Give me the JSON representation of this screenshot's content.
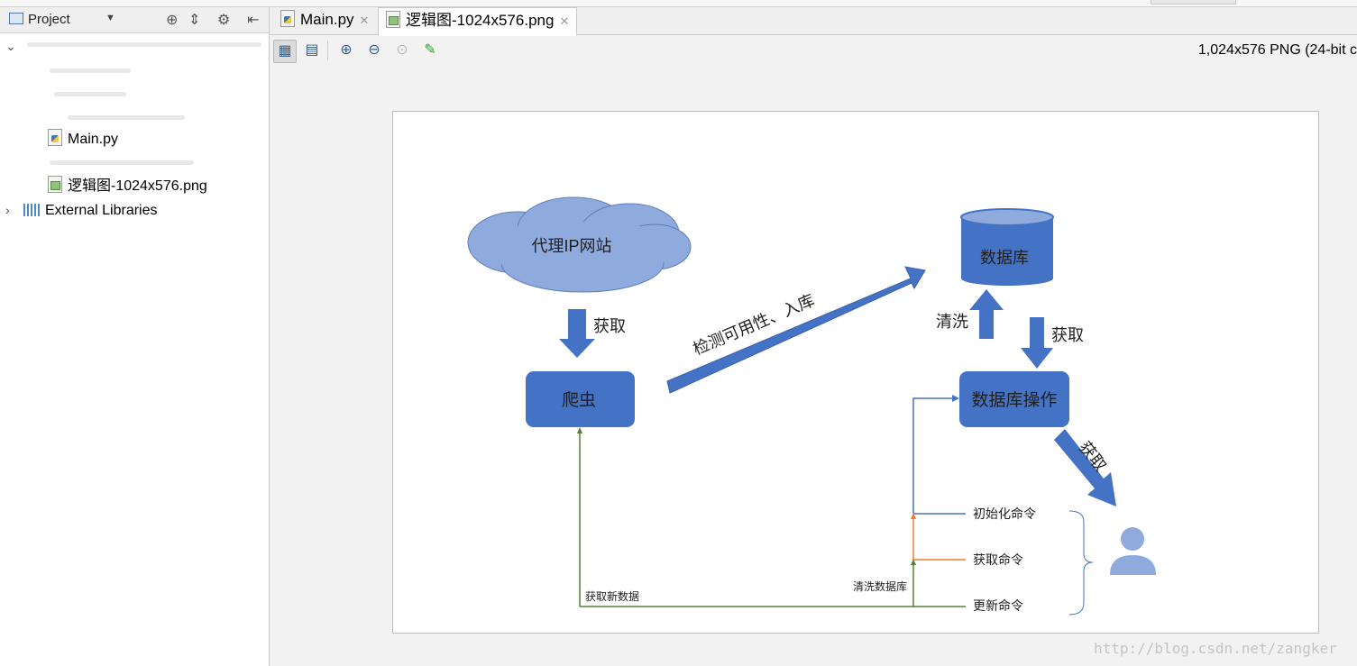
{
  "left_panel": {
    "title": "Project",
    "files": [
      "Main.py",
      "逻辑图-1024x576.png"
    ],
    "external_libraries": "External Libraries"
  },
  "tabs": [
    {
      "label": "Main.py",
      "active": false
    },
    {
      "label": "逻辑图-1024x576.png",
      "active": true
    }
  ],
  "image_info": "1,024x576 PNG (24-bit c",
  "diagram": {
    "proxy_site": "代理IP网站",
    "fetch1": "获取",
    "crawler": "爬虫",
    "check_store": "检测可用性、入库",
    "database": "数据库",
    "clean": "清洗",
    "fetch2": "获取",
    "db_ops": "数据库操作",
    "fetch3": "获取",
    "cmd_init": "初始化命令",
    "cmd_get": "获取命令",
    "cmd_update": "更新命令",
    "get_new_data": "获取新数据",
    "clean_db": "清洗数据库"
  },
  "colors": {
    "accent": "#4472c4",
    "cloud": "#8faadc",
    "user": "#8faadc",
    "green": "#548235",
    "orange": "#ed7d31"
  },
  "watermark": "http://blog.csdn.net/zangker"
}
